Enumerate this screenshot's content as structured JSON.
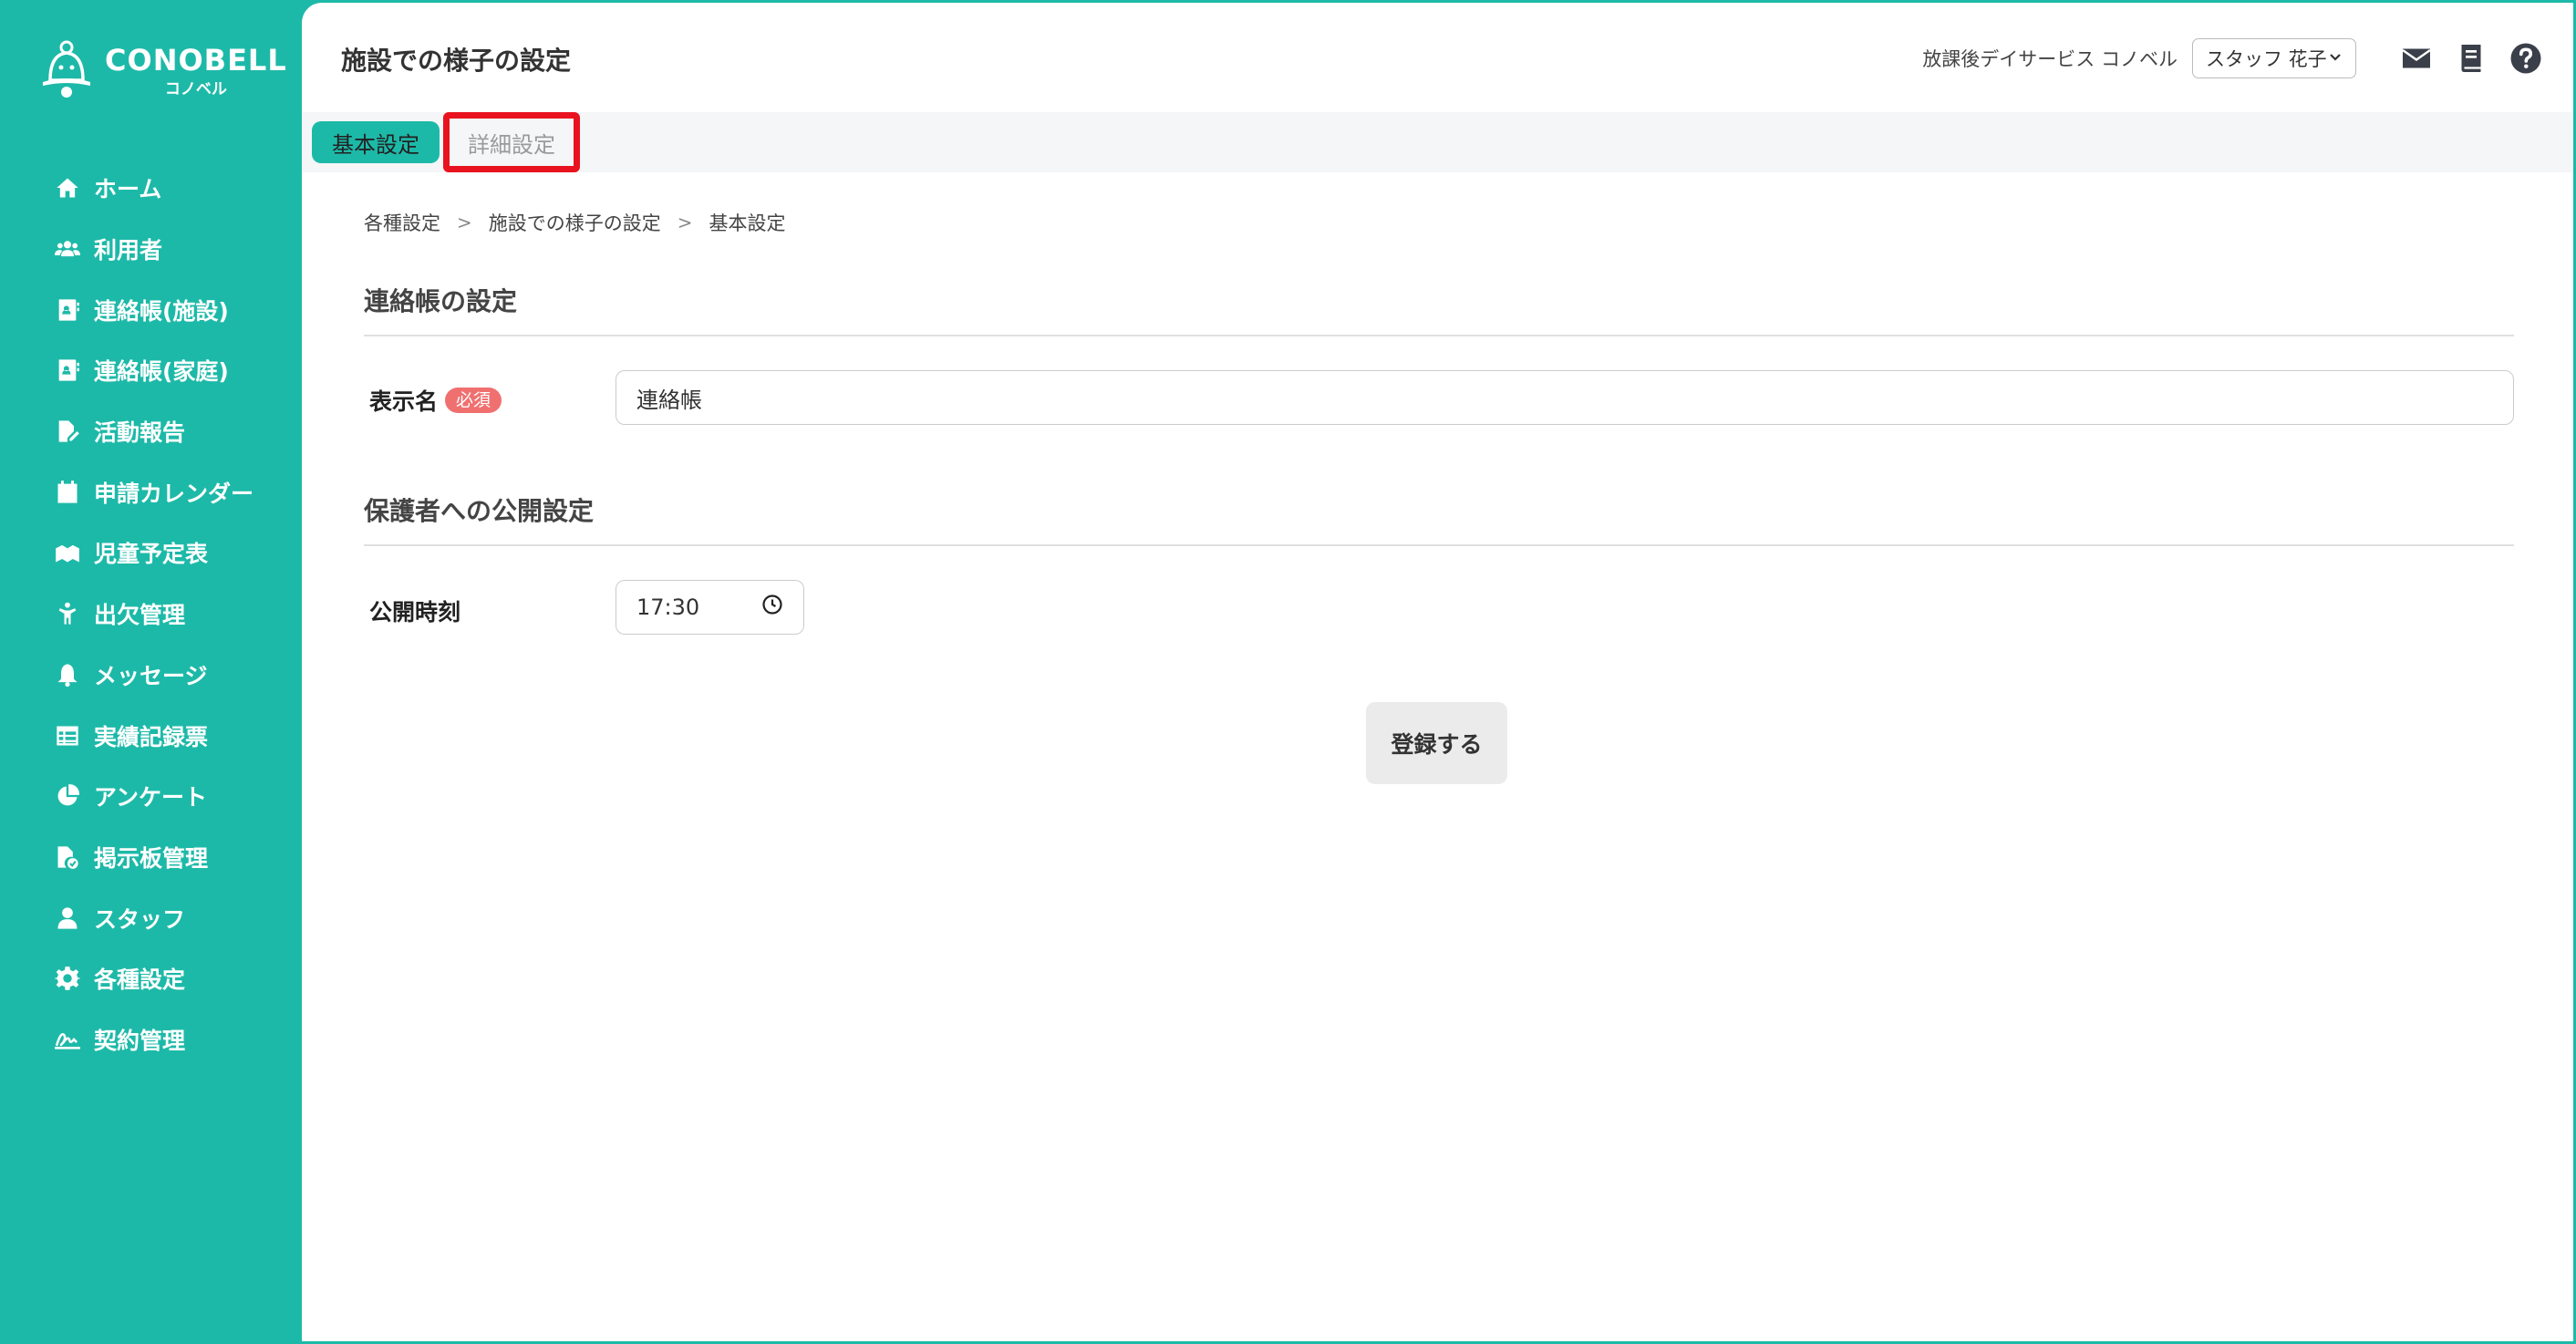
{
  "colors": {
    "brand": "#1db9a8",
    "highlight": "#e8131f",
    "required": "#f07070"
  },
  "logo": {
    "main": "CONOBELL",
    "sub": "コノベル"
  },
  "sidebar": {
    "items": [
      {
        "label": "ホーム",
        "icon": "home-icon"
      },
      {
        "label": "利用者",
        "icon": "users-icon"
      },
      {
        "label": "連絡帳(施設)",
        "icon": "contact-book-icon"
      },
      {
        "label": "連絡帳(家庭)",
        "icon": "contact-book-icon"
      },
      {
        "label": "活動報告",
        "icon": "report-edit-icon"
      },
      {
        "label": "申請カレンダー",
        "icon": "calendar-icon"
      },
      {
        "label": "児童予定表",
        "icon": "schedule-icon"
      },
      {
        "label": "出欠管理",
        "icon": "attendance-icon"
      },
      {
        "label": "メッセージ",
        "icon": "bell-icon"
      },
      {
        "label": "実績記録票",
        "icon": "table-icon"
      },
      {
        "label": "アンケート",
        "icon": "pie-chart-icon"
      },
      {
        "label": "掲示板管理",
        "icon": "file-check-icon"
      },
      {
        "label": "スタッフ",
        "icon": "staff-icon"
      },
      {
        "label": "各種設定",
        "icon": "gear-icon"
      },
      {
        "label": "契約管理",
        "icon": "signature-icon"
      }
    ]
  },
  "header": {
    "title": "施設での様子の設定",
    "facility": "放課後デイサービス コノベル",
    "user": "スタッフ 花子"
  },
  "tabs": {
    "basic": "基本設定",
    "detail": "詳細設定"
  },
  "breadcrumb": [
    "各種設定",
    "施設での様子の設定",
    "基本設定"
  ],
  "sections": {
    "contact": {
      "title": "連絡帳の設定",
      "display_name_label": "表示名",
      "required_badge": "必須",
      "display_name_value": "連絡帳"
    },
    "publish": {
      "title": "保護者への公開設定",
      "time_label": "公開時刻",
      "time_value": "17:30"
    }
  },
  "submit_label": "登録する"
}
